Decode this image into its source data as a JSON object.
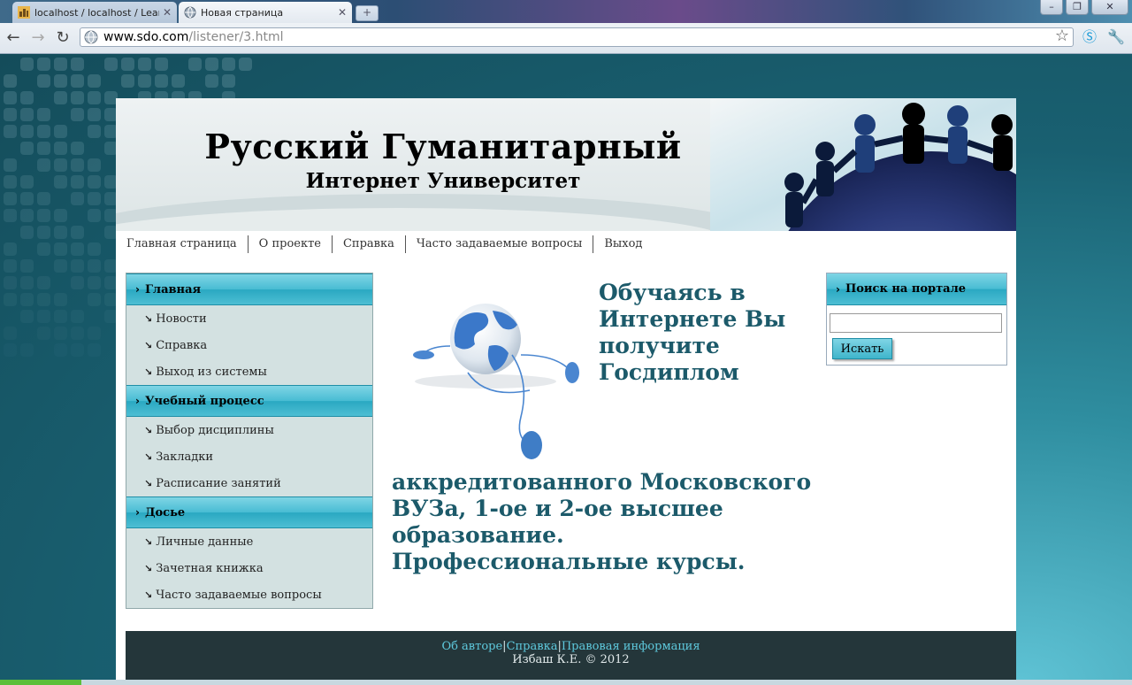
{
  "browser": {
    "tabs": [
      {
        "title": "localhost / localhost / LearnSys",
        "active": false
      },
      {
        "title": "Новая страница",
        "active": true
      }
    ],
    "new_tab": "+",
    "url_host": "www.sdo.com",
    "url_path": "/listener/3.html",
    "window_buttons": {
      "minimize": "–",
      "restore": "❐",
      "close": "✕"
    }
  },
  "site": {
    "title": "Русский Гуманитарный",
    "subtitle": "Интернет Университет",
    "nav": [
      "Главная страница",
      "О проекте",
      "Справка",
      "Часто задаваемые вопросы",
      "Выход"
    ],
    "menu": [
      {
        "heading": "Главная",
        "items": [
          "Новости",
          "Справка",
          "Выход из системы"
        ]
      },
      {
        "heading": "Учебный процесс",
        "items": [
          "Выбор дисциплины",
          "Закладки",
          "Расписание занятий"
        ]
      },
      {
        "heading": "Досье",
        "items": [
          "Личные данные",
          "Зачетная книжка",
          "Часто задаваемые вопросы"
        ]
      }
    ],
    "promo_top": "Обучаясь в Интернете Вы получите Госдиплом",
    "promo_bottom": "аккредитованного Московского ВУЗа, 1-ое и 2-ое высшее образование. Профессиональные курсы.",
    "search": {
      "heading": "Поиск на портале",
      "value": "",
      "button": "Искать"
    },
    "footer": {
      "links": [
        "Об авторе",
        "Справка",
        "Правовая информация"
      ],
      "separator": "|",
      "copyright": "Избаш К.Е. © 2012"
    }
  },
  "colors": {
    "accent": "#3fb5cb",
    "promo_text": "#1c5a6a",
    "footer_bg": "#24363a"
  }
}
